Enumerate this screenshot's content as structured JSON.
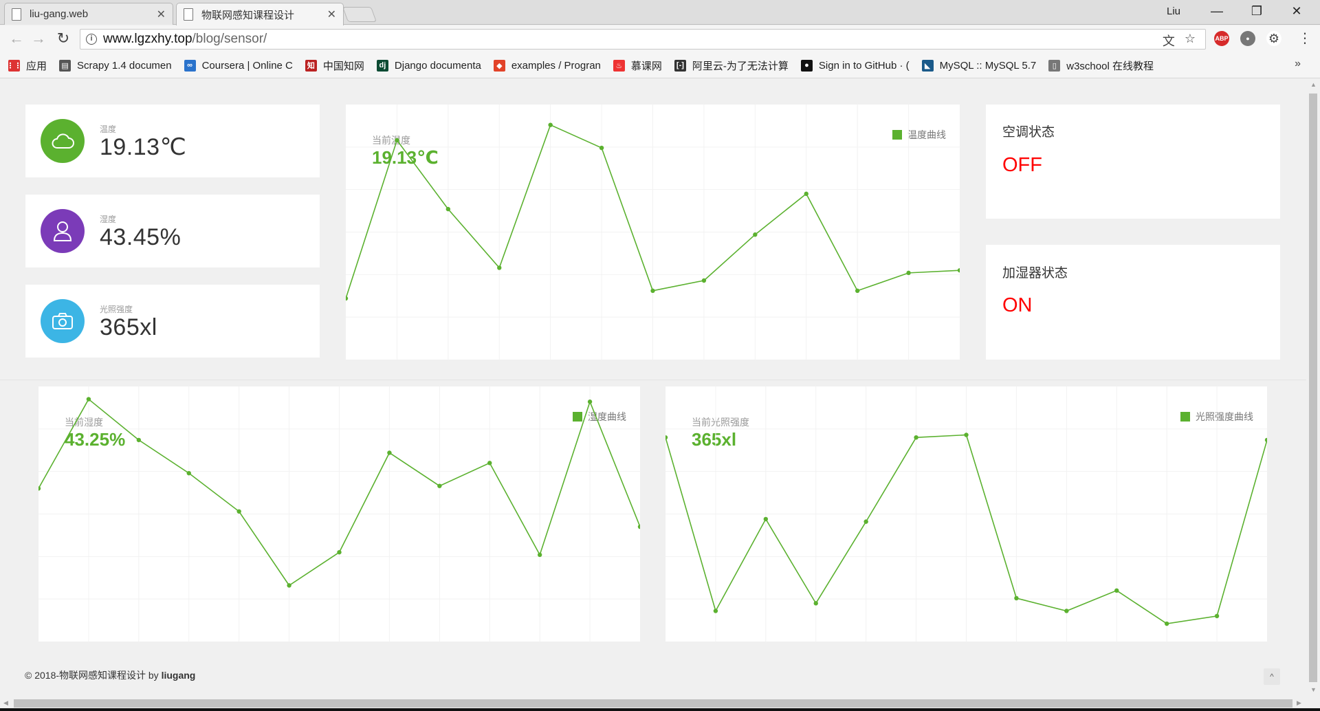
{
  "browser": {
    "tabs": [
      {
        "label": "liu-gang.web",
        "active": false
      },
      {
        "label": "物联网感知课程设计",
        "active": true
      }
    ],
    "profile_name": "Liu",
    "window_controls": {
      "minimize": "—",
      "restore": "❐",
      "close": "✕"
    },
    "url_host": "www.lgzxhy.top",
    "url_path": "/blog/sensor/",
    "bookmarks": [
      {
        "label": "应用",
        "icon": "apps-grid-icon",
        "color": "#d33"
      },
      {
        "label": "Scrapy 1.4 documen",
        "icon": "doc-book-icon",
        "color": "#555"
      },
      {
        "label": "Coursera | Online C",
        "icon": "coursera-icon",
        "color": "#2a73cc"
      },
      {
        "label": "中国知网",
        "icon": "cnki-icon",
        "color": "#b22"
      },
      {
        "label": "Django documenta",
        "icon": "django-icon",
        "color": "#0c4b33"
      },
      {
        "label": "examples / Progran",
        "icon": "gitlab-icon",
        "color": "#e24329"
      },
      {
        "label": "慕课网",
        "icon": "imooc-flame-icon",
        "color": "#e33"
      },
      {
        "label": "阿里云-为了无法计算",
        "icon": "aliyun-icon",
        "color": "#333"
      },
      {
        "label": "Sign in to GitHub · (",
        "icon": "github-icon",
        "color": "#111"
      },
      {
        "label": "MySQL :: MySQL 5.7",
        "icon": "mysql-icon",
        "color": "#1a5a8a"
      },
      {
        "label": "w3school 在线教程",
        "icon": "page-icon",
        "color": "#777"
      }
    ],
    "bookmarks_more": "»"
  },
  "sensors": {
    "temperature": {
      "label": "温度",
      "value": "19.13℃",
      "icon": "cloud-icon",
      "color": "#5bb12f"
    },
    "humidity": {
      "label": "湿度",
      "value": "43.45%",
      "icon": "user-icon",
      "color": "#7b3bb8"
    },
    "light": {
      "label": "光照强度",
      "value": "365xl",
      "icon": "camera-icon",
      "color": "#3cb5e5"
    }
  },
  "status": {
    "ac": {
      "title": "空调状态",
      "value": "OFF"
    },
    "humidifier": {
      "title": "加湿器状态",
      "value": "ON"
    }
  },
  "charts": {
    "temperature": {
      "current_label": "当前温度",
      "current_value": "19.13℃",
      "legend": "温度曲线"
    },
    "humidity": {
      "current_label": "当前湿度",
      "current_value": "43.25%",
      "legend": "湿度曲线"
    },
    "light": {
      "current_label": "当前光照强度",
      "current_value": "365xl",
      "legend": "光照强度曲线"
    }
  },
  "chart_data": [
    {
      "type": "line",
      "series": [
        {
          "name": "温度曲线",
          "values": [
            0.24,
            0.86,
            0.59,
            0.36,
            0.92,
            0.83,
            0.27,
            0.31,
            0.49,
            0.65,
            0.27,
            0.34,
            0.35
          ]
        }
      ],
      "grid": true,
      "legend_position": "top-right",
      "color": "#5bb12f"
    },
    {
      "type": "line",
      "series": [
        {
          "name": "湿度曲线",
          "values": [
            0.6,
            0.95,
            0.79,
            0.66,
            0.51,
            0.22,
            0.35,
            0.74,
            0.61,
            0.7,
            0.34,
            0.94,
            0.45
          ]
        }
      ],
      "grid": true,
      "legend_position": "top-right",
      "color": "#5bb12f"
    },
    {
      "type": "line",
      "series": [
        {
          "name": "光照强度曲线",
          "values": [
            0.8,
            0.12,
            0.48,
            0.15,
            0.47,
            0.8,
            0.81,
            0.17,
            0.12,
            0.2,
            0.07,
            0.1,
            0.79
          ]
        }
      ],
      "grid": true,
      "legend_position": "top-right",
      "color": "#5bb12f"
    }
  ],
  "footer": {
    "text": "© 2018-物联网感知课程设计 by ",
    "author": "liugang",
    "top_button": "^"
  }
}
